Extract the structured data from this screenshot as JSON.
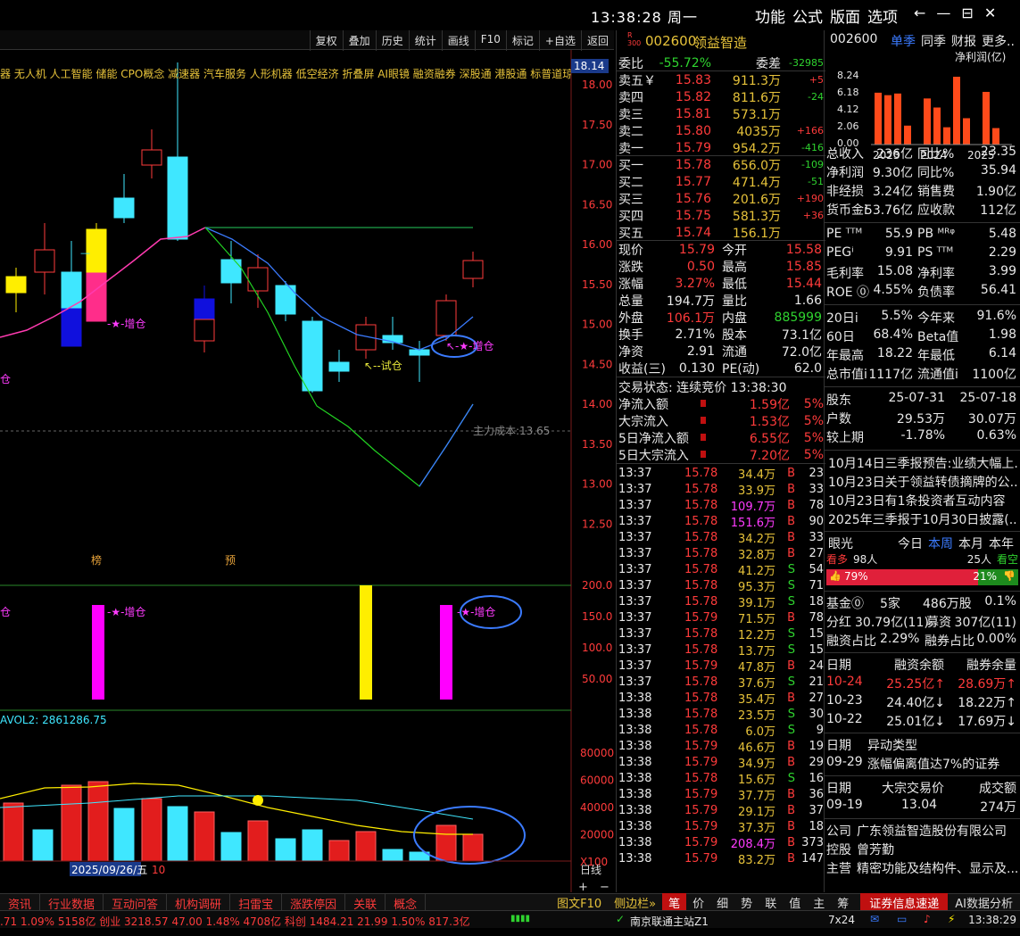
{
  "titlebar": {
    "time": "13:38:28",
    "weekday": "周一",
    "menu": [
      "功能",
      "公式",
      "版面",
      "选项"
    ],
    "ctl": [
      "←",
      "—",
      "⊟",
      "✕"
    ]
  },
  "chart_toolbar": [
    "复权",
    "叠加",
    "历史",
    "统计",
    "画线",
    "F10",
    "标记",
    "+自选",
    "返回"
  ],
  "concepts": "器 无人机 人工智能 储能 CPO概念 减速器 汽车服务 人形机器 低空经济 折叠屏 AI眼镜 融资融券 深股通 港股通 标普道琼斯 富时罗素 MSCI",
  "chart": {
    "price_axis": [
      "18.00",
      "17.50",
      "17.00",
      "16.50",
      "16.00",
      "15.50",
      "15.00",
      "14.50",
      "14.00",
      "13.50",
      "13.00",
      "12.50"
    ],
    "current_price_tag": "18.14",
    "main_cost": "主力成本:13.65",
    "labels": {
      "zengcang1": "增仓",
      "zengcang2": "增仓",
      "zengcang_left": "仓",
      "shicang": "试仓"
    },
    "badges": {
      "bang": "榜",
      "yu": "预"
    },
    "ind_axis": [
      "200.0",
      "150.0",
      "100.0",
      "50.00"
    ],
    "ind_labels": {
      "a": "仓",
      "b": "增仓",
      "c": "增仓"
    },
    "vol_title": "AVOL2: 2861286.75",
    "vol_axis": [
      "80000",
      "60000",
      "40000",
      "20000",
      "X100"
    ],
    "date_label": "2025/09/26/五",
    "date_label2": "10",
    "period": "日线",
    "zoom": [
      "+",
      "−"
    ]
  },
  "quote": {
    "badge": "R 300",
    "code": "002600",
    "name": "领益智造",
    "weibi": {
      "l": "委比",
      "v": "-55.72%",
      "l2": "委差",
      "v2": "-32985"
    },
    "sell": [
      [
        "卖五￥",
        "15.83",
        "911.3万",
        "+5"
      ],
      [
        "卖四",
        "15.82",
        "811.6万",
        "-24"
      ],
      [
        "卖三",
        "15.81",
        "573.1万",
        ""
      ],
      [
        "卖二",
        "15.80",
        "4035万",
        "+166"
      ],
      [
        "卖一",
        "15.79",
        "954.2万",
        "-416"
      ]
    ],
    "buy": [
      [
        "买一",
        "15.78",
        "656.0万",
        "-109"
      ],
      [
        "买二",
        "15.77",
        "471.4万",
        "-51"
      ],
      [
        "买三",
        "15.76",
        "201.6万",
        "+190"
      ],
      [
        "买四",
        "15.75",
        "581.3万",
        "+36"
      ],
      [
        "买五",
        "15.74",
        "156.1万",
        ""
      ]
    ],
    "stats": [
      [
        "现价",
        "15.79",
        "今开",
        "15.58"
      ],
      [
        "涨跌",
        "0.50",
        "最高",
        "15.85"
      ],
      [
        "涨幅",
        "3.27%",
        "最低",
        "15.44"
      ],
      [
        "总量",
        "194.7万",
        "量比",
        "1.66"
      ],
      [
        "外盘",
        "106.1万",
        "内盘",
        "885999"
      ],
      [
        "换手",
        "2.71%",
        "股本",
        "73.1亿"
      ],
      [
        "净资",
        "2.91",
        "流通",
        "72.0亿"
      ],
      [
        "收益(三)",
        "0.130",
        "PE(动)",
        "62.0"
      ]
    ],
    "trade_state": "交易状态: 连续竞价 13:38:30",
    "flows": [
      [
        "净流入额",
        "1.59亿",
        "5%"
      ],
      [
        "大宗流入",
        "1.53亿",
        "5%"
      ],
      [
        "5日净流入额",
        "6.55亿",
        "5%"
      ],
      [
        "5日大宗流入",
        "7.20亿",
        "5%"
      ]
    ],
    "ticks": [
      [
        "13:37",
        "15.78",
        "34.4万",
        "B",
        "23"
      ],
      [
        "13:37",
        "15.78",
        "33.9万",
        "B",
        "33"
      ],
      [
        "13:37",
        "15.78",
        "109.7万",
        "B",
        "78"
      ],
      [
        "13:37",
        "15.78",
        "151.6万",
        "B",
        "90"
      ],
      [
        "13:37",
        "15.78",
        "34.2万",
        "B",
        "33"
      ],
      [
        "13:37",
        "15.78",
        "32.8万",
        "B",
        "27"
      ],
      [
        "13:37",
        "15.78",
        "41.2万",
        "S",
        "54"
      ],
      [
        "13:37",
        "15.78",
        "95.3万",
        "S",
        "71"
      ],
      [
        "13:37",
        "15.78",
        "39.1万",
        "S",
        "18"
      ],
      [
        "13:37",
        "15.79",
        "71.5万",
        "B",
        "78"
      ],
      [
        "13:37",
        "15.78",
        "12.2万",
        "S",
        "15"
      ],
      [
        "13:37",
        "15.78",
        "13.7万",
        "S",
        "15"
      ],
      [
        "13:37",
        "15.79",
        "47.8万",
        "B",
        "24"
      ],
      [
        "13:37",
        "15.78",
        "37.6万",
        "S",
        "21"
      ],
      [
        "13:38",
        "15.78",
        "35.4万",
        "B",
        "27"
      ],
      [
        "13:38",
        "15.78",
        "23.5万",
        "S",
        "30"
      ],
      [
        "13:38",
        "15.78",
        "6.0万",
        "S",
        "9"
      ],
      [
        "13:38",
        "15.79",
        "46.6万",
        "B",
        "19"
      ],
      [
        "13:38",
        "15.79",
        "34.9万",
        "B",
        "29"
      ],
      [
        "13:38",
        "15.78",
        "15.6万",
        "S",
        "16"
      ],
      [
        "13:38",
        "15.79",
        "37.7万",
        "B",
        "36"
      ],
      [
        "13:38",
        "15.79",
        "29.1万",
        "B",
        "37"
      ],
      [
        "13:38",
        "15.79",
        "37.3万",
        "B",
        "18"
      ],
      [
        "13:38",
        "15.79",
        "208.4万",
        "B",
        "373"
      ],
      [
        "13:38",
        "15.79",
        "83.2万",
        "B",
        "147"
      ]
    ]
  },
  "info": {
    "code": "002600",
    "tabs": [
      "单季",
      "同季",
      "财报",
      "更多.."
    ],
    "bar_title": "净利润(亿)",
    "bar_axis": [
      "8.24",
      "6.18",
      "4.12",
      "2.06",
      "0.00"
    ],
    "bar_years": [
      "2023",
      "2024",
      "2025"
    ],
    "bar_values": [
      6.3,
      6.0,
      6.2,
      2.3,
      0.0,
      5.6,
      4.5,
      2.1,
      8.24,
      3.2,
      0.0,
      6.4,
      2.0
    ],
    "fin": [
      [
        "总收入",
        "236亿",
        "同比%",
        "23.35"
      ],
      [
        "净利润",
        "9.30亿",
        "同比%",
        "35.94"
      ],
      [
        "非经损",
        "3.24亿",
        "销售费",
        "1.90亿"
      ],
      [
        "货币金i",
        "53.76亿",
        "应收款",
        "112亿"
      ]
    ],
    "val": [
      [
        "PE ᵀᵀᴹ",
        "55.9",
        "PB ᴹᴿᵠ",
        "5.48"
      ],
      [
        "PEGⁱ",
        "9.91",
        "PS ᵀᵀᴹ",
        "2.29"
      ],
      [
        "毛利率",
        "15.08",
        "净利率",
        "3.99"
      ],
      [
        "ROE ⓪",
        "4.55%",
        "负债率",
        "56.41"
      ]
    ],
    "perf": [
      [
        "20日i",
        "5.5%",
        "今年来",
        "91.6%"
      ],
      [
        "60日",
        "68.4%",
        "Beta值",
        "1.98"
      ],
      [
        "年最高",
        "18.22",
        "年最低",
        "6.14"
      ],
      [
        "总市值i",
        "1117亿",
        "流通值i",
        "1100亿"
      ]
    ],
    "holders": [
      [
        "股东",
        "25-07-31",
        "25-07-18"
      ],
      [
        "户数",
        "29.53万",
        "30.07万"
      ],
      [
        "较上期",
        "-1.78%",
        "0.63%"
      ]
    ],
    "news": [
      "10月14日三季报预告:业绩大幅上...",
      "10月23日关于领益转债摘牌的公...",
      "10月23日有1条投资者互动内容",
      "2025年三季报于10月30日披露(..."
    ],
    "yanguang": {
      "l": "眼光",
      "tabs": [
        "今日",
        "本周",
        "本月",
        "本年"
      ],
      "kanduo": "看多",
      "kd_n": "98人",
      "kankong": "看空",
      "kk_n": "25人",
      "pct_up": "79%",
      "pct_dn": "21%",
      "up_frac": 0.79
    },
    "fund": [
      [
        "基金⓪",
        "5家",
        "486万股",
        "0.1%"
      ],
      [
        "分红",
        "30.79亿(11)",
        "募资",
        "307亿(11)"
      ],
      [
        "融资占比",
        "2.29%",
        "融券占比",
        "0.00%"
      ]
    ],
    "margin_head": [
      "日期",
      "融资余额",
      "融券余量"
    ],
    "margin": [
      [
        "10-24",
        "25.25亿↑",
        "28.69万↑"
      ],
      [
        "10-23",
        "24.40亿↓",
        "18.22万↑"
      ],
      [
        "10-22",
        "25.01亿↓",
        "17.69万↓"
      ]
    ],
    "abn_head": [
      "日期",
      "异动类型"
    ],
    "abn": [
      [
        "09-29",
        "涨幅偏离值达7%的证券"
      ]
    ],
    "block_head": [
      "日期",
      "大宗交易价",
      "成交额"
    ],
    "block": [
      [
        "09-19",
        "13.04",
        "274万"
      ]
    ],
    "company": [
      [
        "公司",
        "广东领益智造股份有限公司"
      ],
      [
        "控股",
        "曾芳勤"
      ],
      [
        "主营",
        "精密功能及结构件、显示及..."
      ]
    ]
  },
  "bottom_tabs": [
    "资讯",
    "行业数据",
    "互动问答",
    "机构调研",
    "扫雷宝",
    "涨跌停因",
    "关联",
    "概念"
  ],
  "bottom_right": [
    "图文F10",
    "侧边栏»",
    "笔",
    "价",
    "细",
    "势",
    "联",
    "值",
    "主",
    "筹"
  ],
  "bottom_promo": "证券信息速递",
  "bottom_ai": "AI数据分析",
  "status": {
    "text": ".71  1.09%  5158亿  创业 3218.57  47.00  1.48%  4708亿  科创 1484.21  21.99  1.50%  817.3亿",
    "server": "南京联通主站Z1",
    "x24": "7x24",
    "time": "13:38:29"
  }
}
